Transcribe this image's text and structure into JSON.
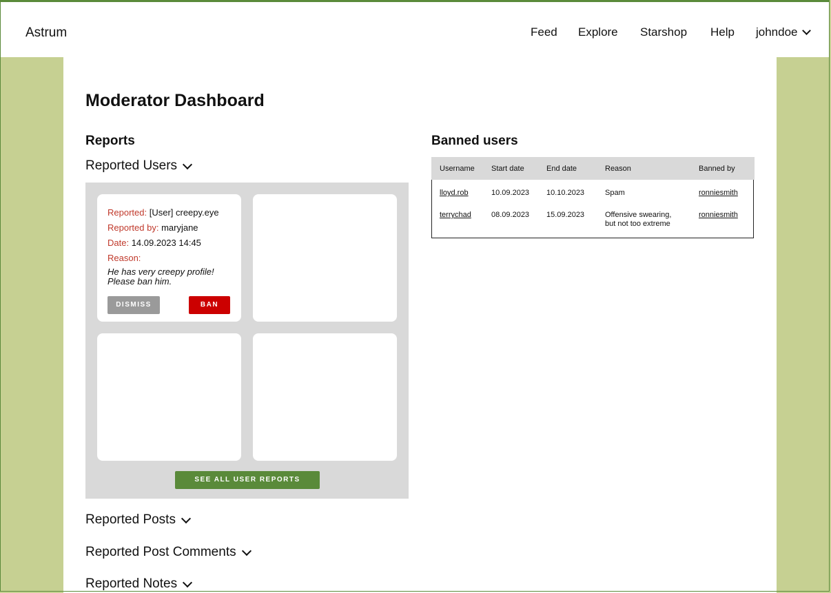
{
  "brand": "Astrum",
  "nav": {
    "feed": "Feed",
    "explore": "Explore",
    "starshop": "Starshop",
    "help": "Help",
    "user": "johndoe"
  },
  "page_title": "Moderator Dashboard",
  "reports": {
    "heading": "Reports",
    "reported_users": "Reported Users",
    "card": {
      "reported_label": "Reported:",
      "reported_value": "[User] creepy.eye",
      "by_label": "Reported by:",
      "by_value": "maryjane",
      "date_label": "Date:",
      "date_value": "14.09.2023 14:45",
      "reason_label": "Reason:",
      "reason_line1": "He has very creepy profile!",
      "reason_line2": "Please ban him.",
      "dismiss": "DISMISS",
      "ban": "BAN"
    },
    "see_all": "SEE ALL USER REPORTS",
    "reported_posts": "Reported Posts",
    "reported_comments": "Reported Post Comments",
    "reported_notes": "Reported Notes"
  },
  "banned": {
    "heading": "Banned users",
    "columns": [
      "Username",
      "Start date",
      "End date",
      "Reason",
      "Banned by"
    ],
    "rows": [
      {
        "username": "lloyd.rob",
        "start": "10.09.2023",
        "end": "10.10.2023",
        "reason1": "Spam",
        "reason2": "",
        "by": "ronniesmith"
      },
      {
        "username": "terrychad",
        "start": "08.09.2023",
        "end": "15.09.2023",
        "reason1": "Offensive swearing,",
        "reason2": "but not too extreme",
        "by": "ronniesmith"
      }
    ]
  }
}
